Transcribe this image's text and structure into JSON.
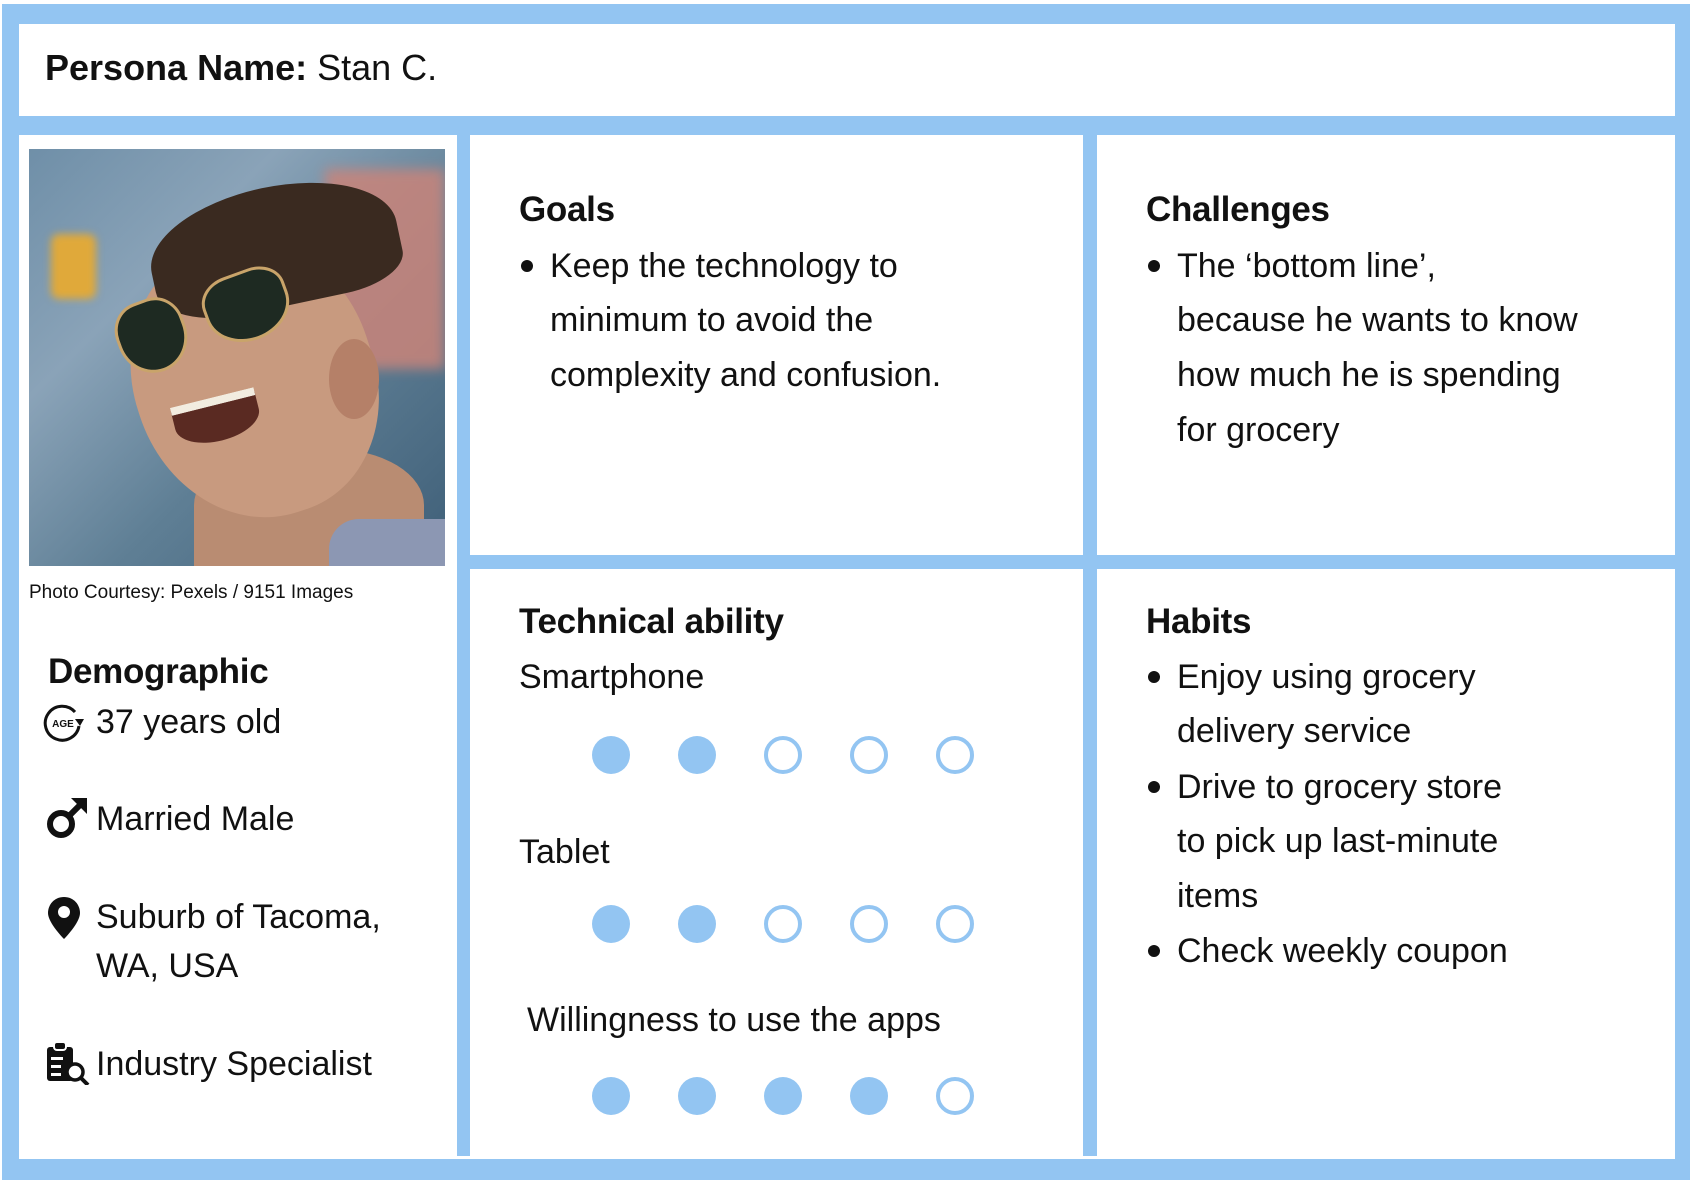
{
  "header": {
    "label": "Persona Name:",
    "name": "Stan C."
  },
  "photo": {
    "alt": "Smiling man wearing aviator sunglasses",
    "caption": "Photo Courtesy: Pexels / 9151 Images"
  },
  "demographic": {
    "heading": "Demographic",
    "items": [
      {
        "icon": "age-icon",
        "lines": [
          "37 years old"
        ]
      },
      {
        "icon": "male-icon",
        "lines": [
          "Married Male"
        ]
      },
      {
        "icon": "location-pin-icon",
        "lines": [
          "Suburb of Tacoma,",
          "WA, USA"
        ]
      },
      {
        "icon": "clipboard-search-icon",
        "lines": [
          "Industry Specialist"
        ]
      }
    ]
  },
  "goals": {
    "heading": "Goals",
    "bullets": [
      {
        "lines": [
          "Keep the technology to",
          "minimum to avoid the",
          "complexity and confusion."
        ]
      }
    ]
  },
  "challenges": {
    "heading": "Challenges",
    "bullets": [
      {
        "lines": [
          "The ‘bottom line’,",
          "because he wants to know",
          "how much he is spending",
          "for grocery"
        ]
      }
    ]
  },
  "technical": {
    "heading": "Technical ability",
    "scale_max": 5,
    "ratings": [
      {
        "label": "Smartphone",
        "value": 2
      },
      {
        "label": "Tablet",
        "value": 2
      },
      {
        "label": "Willingness to use the apps",
        "value": 4
      }
    ]
  },
  "habits": {
    "heading": "Habits",
    "bullets": [
      {
        "lines": [
          "Enjoy using grocery",
          "delivery service"
        ]
      },
      {
        "lines": [
          "Drive to grocery store",
          "to pick up last-minute",
          "items"
        ]
      },
      {
        "lines": [
          "Check weekly coupon"
        ]
      }
    ]
  },
  "colors": {
    "accent": "#93c5f2",
    "text": "#111111",
    "panel": "#ffffff"
  }
}
